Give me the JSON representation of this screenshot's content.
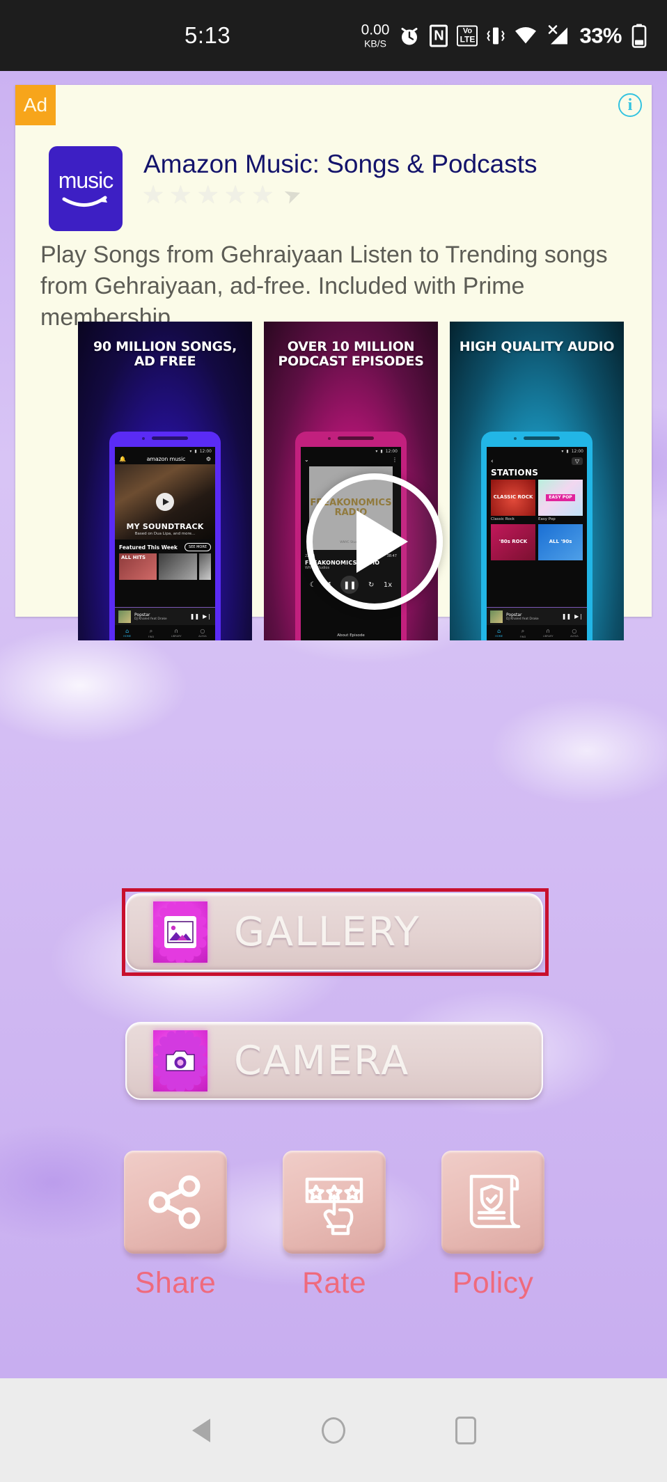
{
  "status_bar": {
    "time": "5:13",
    "net_speed_value": "0.00",
    "net_speed_unit": "KB/S",
    "alarm_icon": "alarm-clock-icon",
    "nfc_icon": "nfc-icon",
    "nfc_label": "N",
    "volte_icon": "volte-icon",
    "volte_top": "Vo",
    "volte_bottom": "LTE",
    "vibrate_icon": "vibrate-icon",
    "wifi_icon": "wifi-icon",
    "signal_icon": "signal-no-service-icon",
    "battery_percent": "33%",
    "battery_icon": "battery-icon"
  },
  "ad": {
    "badge_label": "Ad",
    "info_icon": "info-icon",
    "info_label": "i",
    "app_icon_label": "music",
    "app_icon_name": "amazon-music-icon",
    "title": "Amazon Music: Songs & Podcasts",
    "rating_stars": 5,
    "star_glyph": "★",
    "cursor_glyph": "➤",
    "body": "Play Songs from Gehraiyaan Listen to Trending songs from Gehraiyaan, ad-free. Included with Prime membership",
    "play_overlay_icon": "play-button-overlay",
    "promos": [
      {
        "headline": "90 MILLION SONGS, AD FREE",
        "screen": {
          "status_time": "12:00",
          "brand": "amazon music",
          "bell_icon": "bell-icon",
          "gear_icon": "gear-icon",
          "hero_title": "MY SOUNDTRACK",
          "hero_sub": "Based on Dua Lipa, and more...",
          "featured_label": "Featured This Week",
          "see_more": "SEE MORE",
          "tile_label": "ALL HITS",
          "now_playing_title": "Popstar",
          "now_playing_artist": "DJ Khaled feat Drake",
          "tabs": [
            "HOME",
            "FIND",
            "LIBRARY",
            "ALEXA"
          ]
        }
      },
      {
        "headline": "OVER 10 MILLION PODCAST EPISODES",
        "screen": {
          "status_time": "12:00",
          "art_title": "FREAKONOMICS RADIO",
          "art_sub": "WNYC Studios",
          "elapsed": "22:15",
          "duration": "38:47",
          "title": "FREAKONOMICS RADIO",
          "subtitle": "WNYC Studios",
          "speed": "1x",
          "about_label": "About Episode"
        }
      },
      {
        "headline": "HIGH QUALITY AUDIO",
        "screen": {
          "status_time": "12:00",
          "back_icon": "back-chevron-icon",
          "filter_icon": "filter-icon",
          "title": "STATIONS",
          "stations": [
            {
              "art_label": "CLASSIC ROCK",
              "caption": "Classic Rock"
            },
            {
              "art_label": "EASY POP",
              "caption": "Easy Pop"
            },
            {
              "art_label": "'80s ROCK",
              "caption": ""
            },
            {
              "art_label": "ALL '90s",
              "caption": ""
            }
          ],
          "now_playing_title": "Popstar",
          "now_playing_artist": "DJ Khaled feat Drake",
          "tabs": [
            "HOME",
            "FIND",
            "LIBRARY",
            "ALEXA"
          ]
        }
      }
    ]
  },
  "main": {
    "gallery_button": {
      "label": "GALLERY",
      "icon": "image-picture-icon",
      "selected": true,
      "selection_color": "#c8102e"
    },
    "camera_button": {
      "label": "CAMERA",
      "icon": "camera-icon",
      "selected": false
    },
    "actions": [
      {
        "label": "Share",
        "icon": "share-icon"
      },
      {
        "label": "Rate",
        "icon": "rate-stars-hand-icon"
      },
      {
        "label": "Policy",
        "icon": "policy-document-shield-icon"
      }
    ],
    "label_color": "#ef6a7d"
  },
  "navbar": {
    "back": "back-nav-button",
    "home": "home-nav-button",
    "recents": "recents-nav-button"
  }
}
